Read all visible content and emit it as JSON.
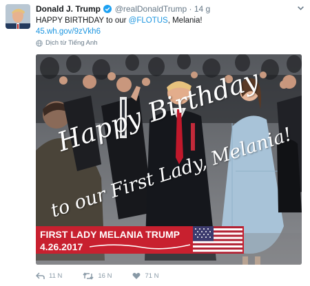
{
  "tweet": {
    "author_name": "Donald J. Trump",
    "handle": "@realDonaldTrump",
    "separator": "·",
    "timestamp": "14 g",
    "text_prefix": "HAPPY BIRTHDAY to our ",
    "mention": "@FLOTUS",
    "text_suffix": ", Melania!",
    "link": "45.wh.gov/9zVkh6",
    "translate_label": "Dịch từ Tiếng Anh"
  },
  "media": {
    "caption_line1": "Happy Birthday",
    "caption_line2": "to our First Lady, Melania!",
    "banner_title": "FIRST LADY MELANIA TRUMP",
    "banner_date": "4.26.2017",
    "banner_color": "#c8202f"
  },
  "actions": {
    "reply_count": "11 N",
    "retweet_count": "16 N",
    "like_count": "71 N"
  },
  "colors": {
    "link": "#1b95e0",
    "muted": "#657786",
    "verified": "#1da1f2"
  },
  "icons": [
    "avatar",
    "verified-badge-icon",
    "chevron-down-icon",
    "globe-icon",
    "reply-icon",
    "retweet-icon",
    "heart-icon"
  ]
}
